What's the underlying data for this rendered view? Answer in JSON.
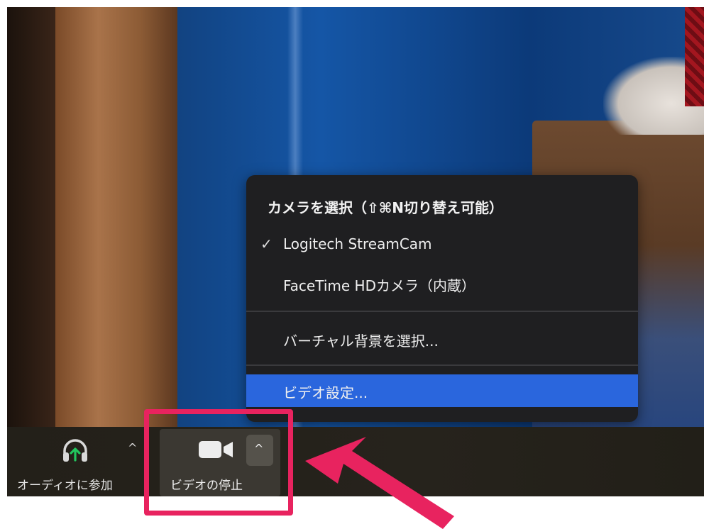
{
  "camera_menu": {
    "header": "カメラを選択（⇧⌘N切り替え可能）",
    "cameras": [
      {
        "label": "Logitech StreamCam",
        "checked": true
      },
      {
        "label": "FaceTime HDカメラ（内蔵）",
        "checked": false
      }
    ],
    "virtual_background": "バーチャル背景を選択...",
    "video_settings": "ビデオ設定...",
    "check_mark": "✓"
  },
  "toolbar": {
    "audio_label": "オーディオに参加",
    "video_label": "ビデオの停止",
    "caret": "^"
  },
  "colors": {
    "menu_bg": "#1f1f21",
    "selected_bg": "#2a66dd",
    "highlight": "#e8235f",
    "audio_icon_accent": "#22c55e"
  },
  "icons": {
    "audio": "headphone-icon",
    "video": "video-camera-icon",
    "annotation": "arrow-icon"
  }
}
